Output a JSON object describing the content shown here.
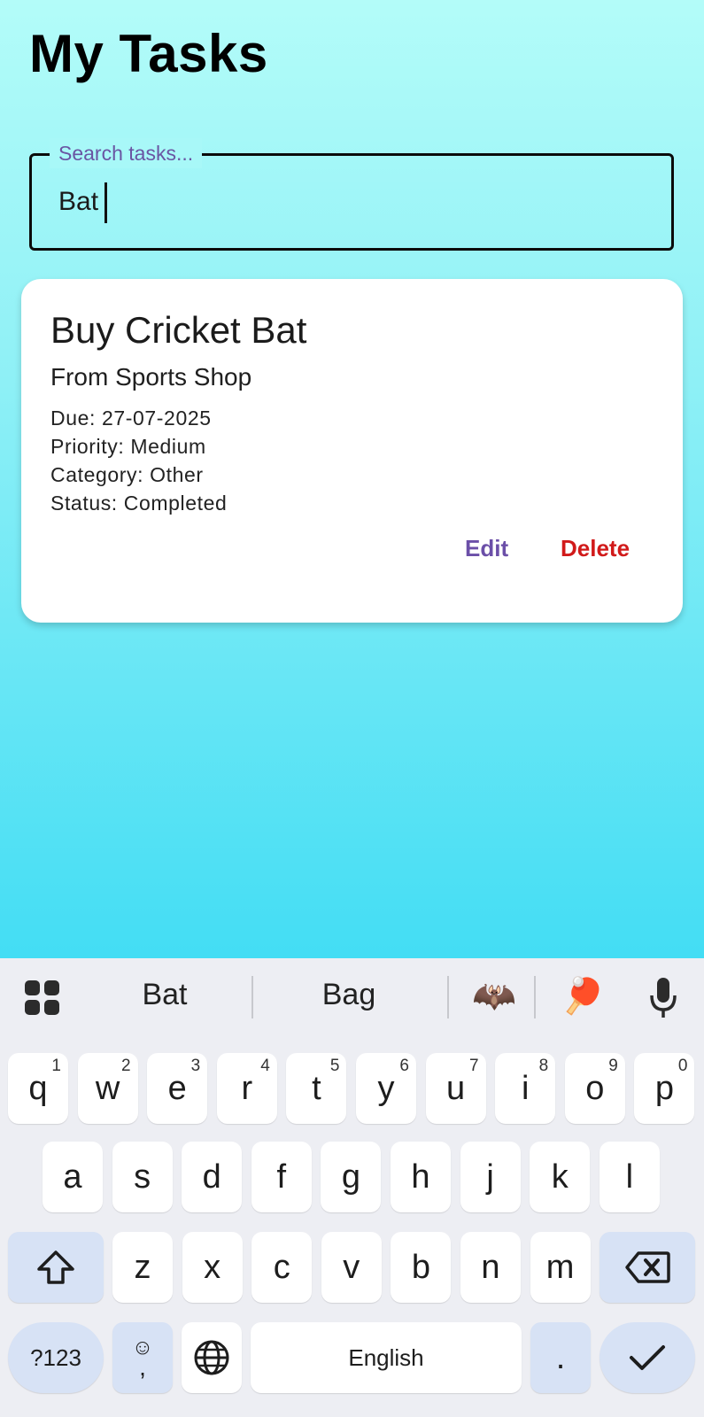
{
  "header": {
    "title": "My Tasks"
  },
  "search": {
    "label": "Search tasks...",
    "value": "Bat"
  },
  "task": {
    "title": "Buy Cricket Bat",
    "description": "From Sports Shop",
    "due": "Due: 27-07-2025",
    "priority": "Priority: Medium",
    "category": "Category: Other",
    "status": "Status: Completed",
    "edit_label": "Edit",
    "delete_label": "Delete"
  },
  "keyboard": {
    "suggestions": [
      "Bat",
      "Bag"
    ],
    "emoji_suggestions": [
      "🦇",
      "🏓"
    ],
    "row1": [
      {
        "k": "q",
        "h": "1"
      },
      {
        "k": "w",
        "h": "2"
      },
      {
        "k": "e",
        "h": "3"
      },
      {
        "k": "r",
        "h": "4"
      },
      {
        "k": "t",
        "h": "5"
      },
      {
        "k": "y",
        "h": "6"
      },
      {
        "k": "u",
        "h": "7"
      },
      {
        "k": "i",
        "h": "8"
      },
      {
        "k": "o",
        "h": "9"
      },
      {
        "k": "p",
        "h": "0"
      }
    ],
    "row2": [
      "a",
      "s",
      "d",
      "f",
      "g",
      "h",
      "j",
      "k",
      "l"
    ],
    "row3": [
      "z",
      "x",
      "c",
      "v",
      "b",
      "n",
      "m"
    ],
    "symbols_label": "?123",
    "emoji_comma_top": "☺",
    "emoji_comma_bottom": ",",
    "space_label": "English",
    "period_label": ".",
    "colors": {
      "key_bg": "#ffffff",
      "func_key_bg": "#d7e2f5",
      "keyboard_bg": "#edeef3"
    }
  }
}
